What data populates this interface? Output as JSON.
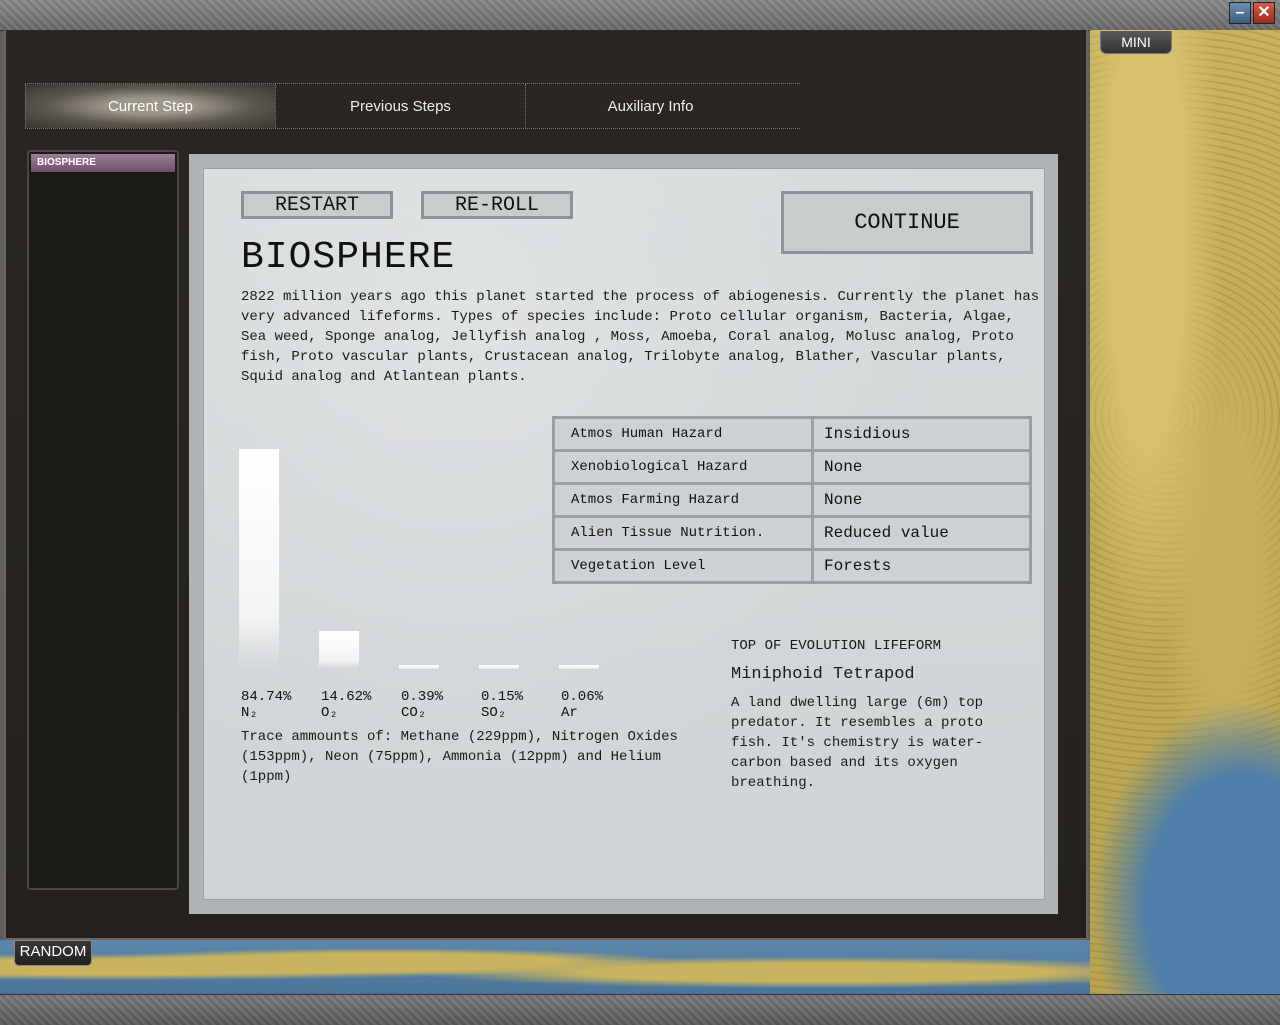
{
  "window": {
    "minimize_icon": "minimize-icon",
    "close_icon": "close-icon"
  },
  "map": {
    "mini_label": "MINI"
  },
  "random_label": "RANDOM",
  "tabs": [
    {
      "label": "Current Step",
      "active": true
    },
    {
      "label": "Previous Steps",
      "active": false
    },
    {
      "label": "Auxiliary Info",
      "active": false
    }
  ],
  "side_list": {
    "items": [
      "BIOSPHERE"
    ]
  },
  "buttons": {
    "restart": "RESTART",
    "reroll": "RE-ROLL",
    "continue": "CONTINUE"
  },
  "heading": "BIOSPHERE",
  "description": "2822 million years ago this planet started the process of abiogenesis. Currently the planet has very advanced lifeforms. Types of species include: Proto cellular organism, Bacteria, Algae, Sea weed, Sponge analog, Jellyfish analog , Moss, Amoeba, Coral analog, Molusc analog, Proto fish, Proto vascular plants, Crustacean analog, Trilobyte analog, Blather, Vascular plants, Squid analog and Atlantean plants.",
  "hazards": [
    {
      "key": "Atmos Human Hazard",
      "value": "Insidious"
    },
    {
      "key": "Xenobiological Hazard",
      "value": "None"
    },
    {
      "key": "Atmos Farming Hazard",
      "value": "None"
    },
    {
      "key": "Alien Tissue Nutrition.",
      "value": "Reduced value"
    },
    {
      "key": "Vegetation Level",
      "value": "Forests"
    }
  ],
  "chart_data": {
    "type": "bar",
    "categories": [
      "N₂",
      "O₂",
      "CO₂",
      "SO₂",
      "Ar"
    ],
    "values": [
      84.74,
      14.62,
      0.39,
      0.15,
      0.06
    ],
    "value_labels": [
      "84.74%",
      "14.62%",
      "0.39%",
      "0.15%",
      "0.06%"
    ],
    "unit": "%",
    "ylim": [
      0,
      100
    ]
  },
  "trace": "Trace ammounts of: Methane (229ppm), Nitrogen Oxides (153ppm), Neon (75ppm), Ammonia (12ppm) and Helium (1ppm)",
  "lifeform": {
    "title": "TOP OF EVOLUTION LIFEFORM",
    "name": "Miniphoid Tetrapod",
    "description": "A land dwelling large (6m)  top predator. It resembles a proto fish. It's chemistry is water-carbon based and its oxygen breathing."
  }
}
